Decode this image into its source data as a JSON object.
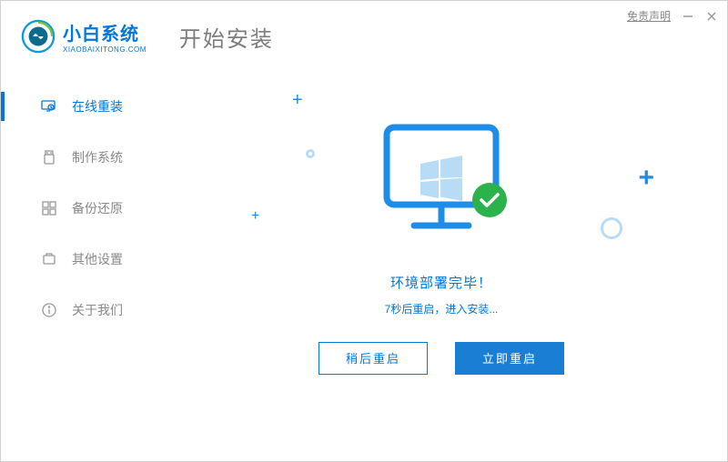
{
  "titlebar": {
    "disclaimer": "免责声明"
  },
  "brand": {
    "name": "小白系统",
    "sub": "XIAOBAIXITONG.COM"
  },
  "page_title": "开始安装",
  "sidebar": {
    "items": [
      {
        "label": "在线重装",
        "icon": "reinstall-icon"
      },
      {
        "label": "制作系统",
        "icon": "usb-icon"
      },
      {
        "label": "备份还原",
        "icon": "backup-icon"
      },
      {
        "label": "其他设置",
        "icon": "settings-icon"
      },
      {
        "label": "关于我们",
        "icon": "info-icon"
      }
    ]
  },
  "main": {
    "status_title": "环境部署完毕！",
    "status_sub": "7秒后重启，进入安装...",
    "countdown_seconds": 7,
    "btn_later": "稍后重启",
    "btn_now": "立即重启"
  }
}
